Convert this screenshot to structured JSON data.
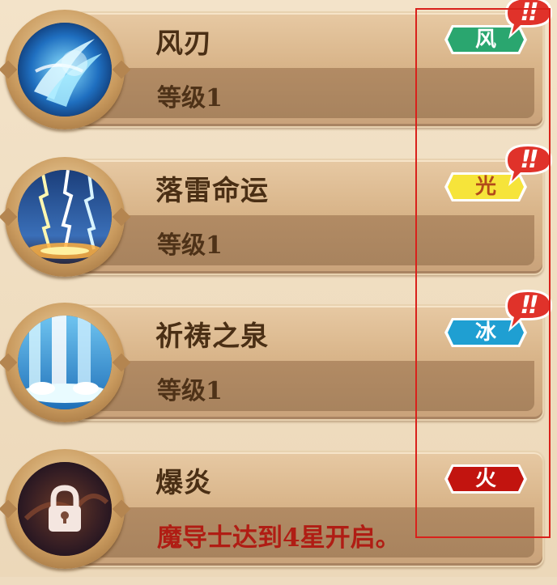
{
  "skills": [
    {
      "name": "风刃",
      "level_text": "等级1",
      "element": "风",
      "element_color": "#2aa66f",
      "element_text_color": "#ffffff",
      "icon": "wind-blade-icon",
      "alert": "!!",
      "locked": false
    },
    {
      "name": "落雷命运",
      "level_text": "等级1",
      "element": "光",
      "element_color": "#f6e43a",
      "element_text_color": "#b24a1a",
      "icon": "lightning-icon",
      "alert": "!!",
      "locked": false
    },
    {
      "name": "祈祷之泉",
      "level_text": "等级1",
      "element": "冰",
      "element_color": "#1f9fd2",
      "element_text_color": "#ffffff",
      "icon": "fountain-icon",
      "alert": "!!",
      "locked": false
    },
    {
      "name": "爆炎",
      "level_text": "魔导士达到4星开启。",
      "element": "火",
      "element_color": "#c2140f",
      "element_text_color": "#ffffff",
      "icon": "lock-icon",
      "alert": "",
      "locked": true
    }
  ],
  "colors": {
    "alert_bubble": "#e0322a",
    "highlight": "#d9211b"
  }
}
